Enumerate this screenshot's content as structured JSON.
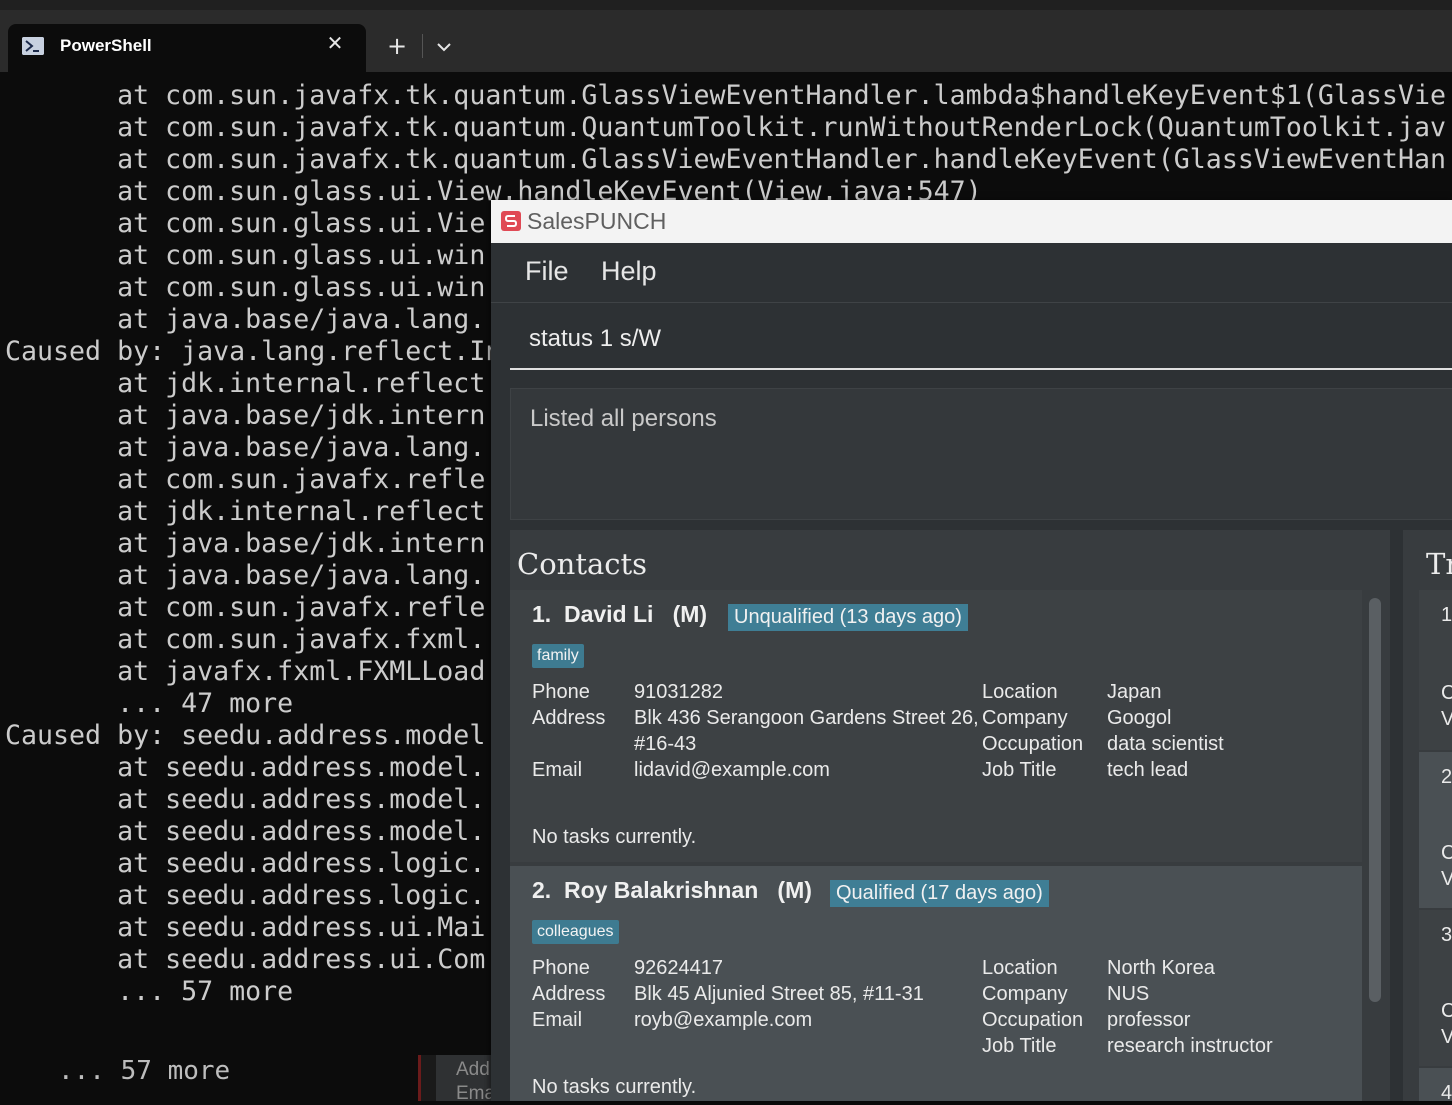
{
  "terminal": {
    "tab_title": "PowerShell",
    "new_tab_symbol": "+",
    "close_symbol": "✕",
    "lines": [
      "       at com.sun.javafx.tk.quantum.GlassViewEventHandler.lambda$handleKeyEvent$1(GlassVie",
      "       at com.sun.javafx.tk.quantum.QuantumToolkit.runWithoutRenderLock(QuantumToolkit.jav",
      "       at com.sun.javafx.tk.quantum.GlassViewEventHandler.handleKeyEvent(GlassViewEventHan",
      "       at com.sun.glass.ui.View.handleKeyEvent(View.java:547)",
      "       at com.sun.glass.ui.Vie",
      "       at com.sun.glass.ui.win",
      "       at com.sun.glass.ui.win",
      "       at java.base/java.lang.",
      "Caused by: java.lang.reflect.In",
      "       at jdk.internal.reflect",
      "       at java.base/jdk.intern",
      "       at java.base/java.lang.",
      "       at com.sun.javafx.refle",
      "       at jdk.internal.reflect",
      "       at java.base/jdk.intern",
      "       at java.base/java.lang.",
      "       at com.sun.javafx.refle",
      "       at com.sun.javafx.fxml.",
      "       at javafx.fxml.FXMLLoad",
      "       ... 47 more",
      "Caused by: seedu.address.model.",
      "       at seedu.address.model.",
      "       at seedu.address.model.",
      "       at seedu.address.model.",
      "       at seedu.address.logic.",
      "       at seedu.address.logic.",
      "       at seedu.address.ui.Mai",
      "       at seedu.address.ui.Com",
      "       ... 57 more"
    ],
    "background_line": "... 57 more"
  },
  "background_app": {
    "line1": "Add",
    "line2": "Ema"
  },
  "app": {
    "title": "SalesPUNCH",
    "menu": {
      "file": "File",
      "help": "Help"
    },
    "command": "status 1 s/W",
    "result": "Listed all persons",
    "contacts_header": "Contacts",
    "tasks_header": "Tr",
    "contacts": [
      {
        "name": "1.  David Li   (M)",
        "status": "Unqualified (13 days ago)",
        "status_color": "#3f7e95",
        "tag": "family",
        "labels_left": [
          "Phone",
          "Address",
          "",
          "Email"
        ],
        "values_left": [
          "91031282",
          "Blk 436 Serangoon Gardens Street 26,",
          "#16-43",
          "lidavid@example.com"
        ],
        "labels_right": [
          "Location",
          "Company",
          "Occupation",
          "Job Title"
        ],
        "values_right": [
          "Japan",
          "Googol",
          "data scientist",
          "tech lead"
        ],
        "tasks": "No tasks currently."
      },
      {
        "name": "2.  Roy Balakrishnan   (M)",
        "status": "Qualified (17 days ago)",
        "status_color": "#3f7e95",
        "tag": "colleagues",
        "labels_left": [
          "Phone",
          "Address",
          "Email"
        ],
        "values_left": [
          "92624417",
          "Blk 45 Aljunied Street 85, #11-31",
          "royb@example.com"
        ],
        "labels_right": [
          "Location",
          "Company",
          "Occupation",
          "Job Title"
        ],
        "values_right": [
          "North Korea",
          "NUS",
          "professor",
          "research instructor"
        ],
        "tasks": "No tasks currently."
      }
    ],
    "task_cards": [
      {
        "num": "1",
        "line1": "C",
        "line2": "V"
      },
      {
        "num": "2",
        "line1": "C",
        "line2": "V"
      },
      {
        "num": "3",
        "line1": "C",
        "line2": "V"
      },
      {
        "num": "4"
      }
    ]
  }
}
